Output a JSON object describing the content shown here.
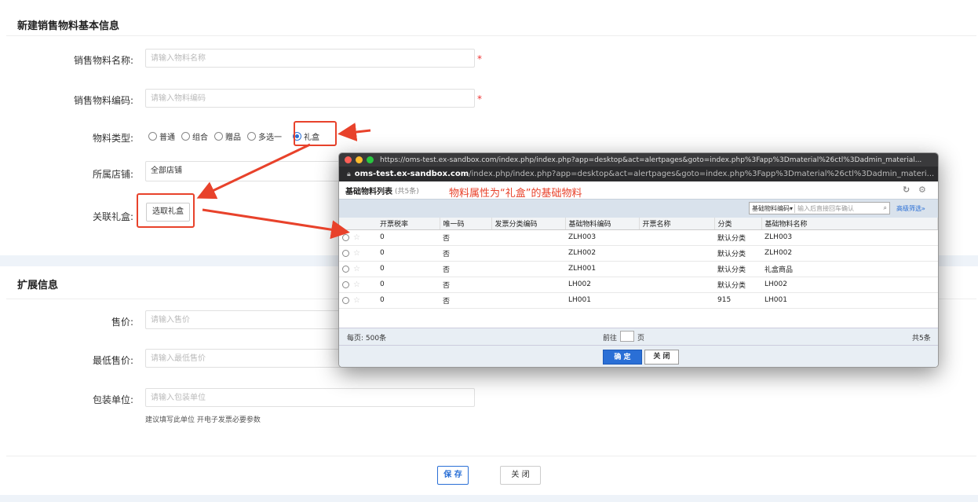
{
  "form": {
    "title": "新建销售物料基本信息",
    "name_label": "销售物料名称:",
    "name_placeholder": "请输入物料名称",
    "code_label": "销售物料编码:",
    "code_placeholder": "请输入物料编码",
    "required_mark": "*",
    "type_label": "物料类型:",
    "type_options": [
      "普通",
      "组合",
      "赠品",
      "多选一",
      "礼盒"
    ],
    "type_selected": "礼盒",
    "shop_label": "所属店铺:",
    "shop_value": "全部店铺",
    "gift_label": "关联礼盒:",
    "gift_button": "选取礼盒"
  },
  "ext": {
    "title": "扩展信息",
    "price_label": "售价:",
    "price_placeholder": "请输入售价",
    "min_price_label": "最低售价:",
    "min_price_placeholder": "请输入最低售价",
    "unit_label": "包装单位:",
    "unit_placeholder": "请输入包装单位",
    "unit_hint": "建议填写此单位 开电子发票必要参数"
  },
  "footer": {
    "save": "保 存",
    "close": "关 闭"
  },
  "popup": {
    "window_url": "https://oms-test.ex-sandbox.com/index.php/index.php?app=desktop&act=alertpages&goto=index.php%3Fapp%3Dmaterial%26ctl%3Dadmin_material...",
    "address_host": "oms-test.ex-sandbox.com",
    "address_path": "/index.php/index.php?app=desktop&act=alertpages&goto=index.php%3Fapp%3Dmaterial%26ctl%3Dadmin_materi...",
    "title": "基础物料列表",
    "count": "(共5条)",
    "annotation": "物料属性为“礼盒”的基础物料",
    "search_field": "基础物料编码▾",
    "search_placeholder": "输入后直接回车确认",
    "advanced": "高级筛选»",
    "columns": [
      "开票税率",
      "唯一码",
      "发票分类编码",
      "基础物料编码",
      "开票名称",
      "分类",
      "基础物料名称"
    ],
    "rows": [
      {
        "tax": "0",
        "unique": "否",
        "inv_code": "",
        "code": "ZLH003",
        "inv_name": "",
        "cat": "默认分类",
        "name": "ZLH003"
      },
      {
        "tax": "0",
        "unique": "否",
        "inv_code": "",
        "code": "ZLH002",
        "inv_name": "",
        "cat": "默认分类",
        "name": "ZLH002"
      },
      {
        "tax": "0",
        "unique": "否",
        "inv_code": "",
        "code": "ZLH001",
        "inv_name": "",
        "cat": "默认分类",
        "name": "礼盒商品"
      },
      {
        "tax": "0",
        "unique": "否",
        "inv_code": "",
        "code": "LH002",
        "inv_name": "",
        "cat": "默认分类",
        "name": "LH002"
      },
      {
        "tax": "0",
        "unique": "否",
        "inv_code": "",
        "code": "LH001",
        "inv_name": "",
        "cat": "915",
        "name": "LH001"
      }
    ],
    "per_page": "每页: 500条",
    "goto_prefix": "前往",
    "goto_suffix": "页",
    "total": "共5条",
    "ok": "确 定",
    "close": "关 闭"
  },
  "colors": {
    "accent": "#2a6fd6",
    "annotation": "#e8422b",
    "band": "#eef3f9"
  }
}
